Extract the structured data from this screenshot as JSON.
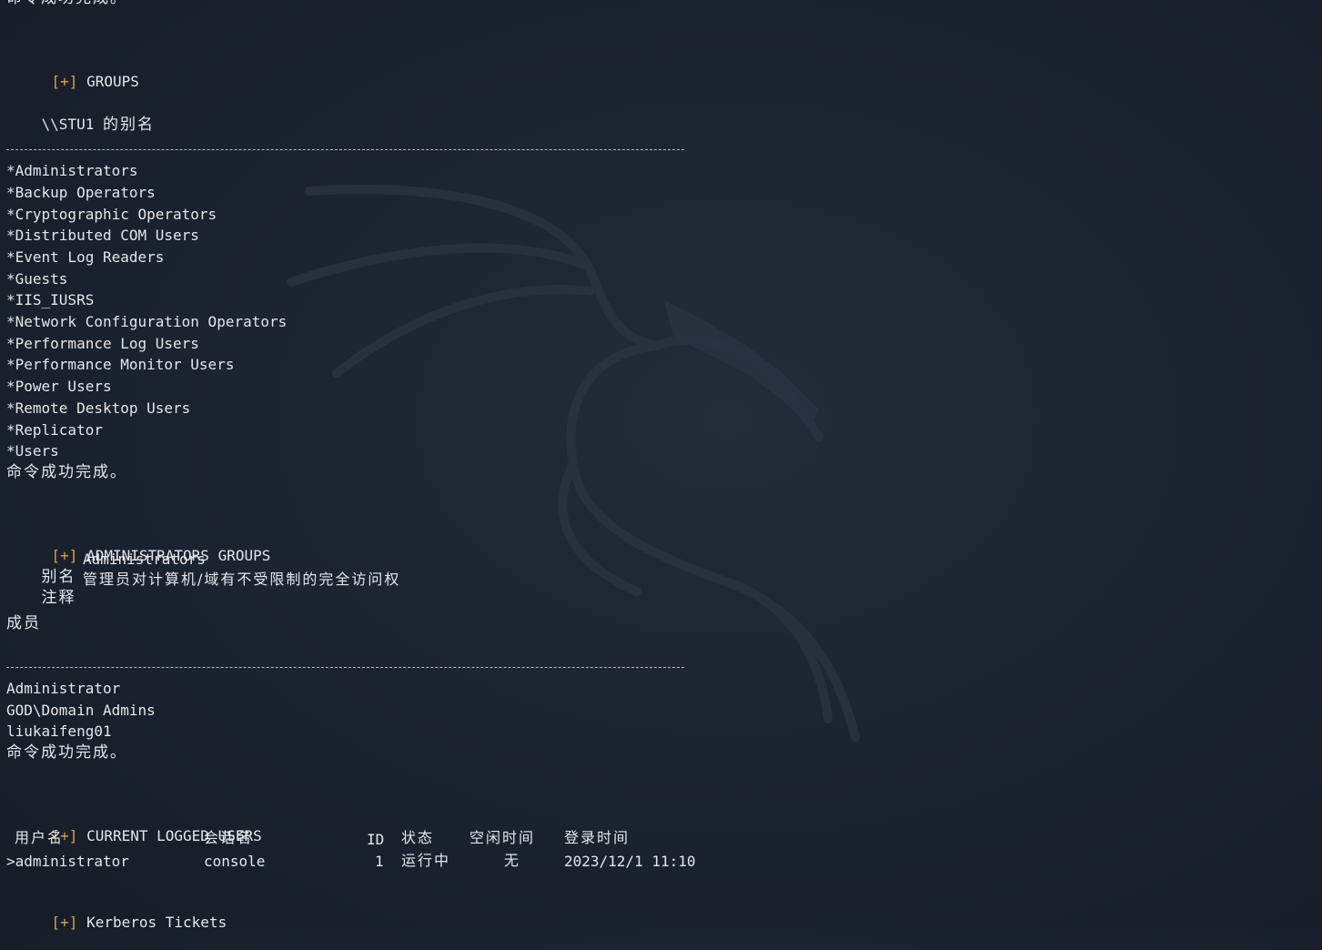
{
  "top_partial": "命令成功完成。",
  "groups_section": {
    "marker": "[+]",
    "title": "GROUPS",
    "alias_host": "\\\\STU1",
    "alias_suffix": "的别名",
    "separator": "-------------------------------------------------------------------------------",
    "items": [
      "*Administrators",
      "*Backup Operators",
      "*Cryptographic Operators",
      "*Distributed COM Users",
      "*Event Log Readers",
      "*Guests",
      "*IIS_IUSRS",
      "*Network Configuration Operators",
      "*Performance Log Users",
      "*Performance Monitor Users",
      "*Power Users",
      "*Remote Desktop Users",
      "*Replicator",
      "*Users"
    ],
    "done": "命令成功完成。"
  },
  "admin_section": {
    "marker": "[+]",
    "title": "ADMINISTRATORS GROUPS",
    "alias_label": "别名",
    "alias_value": "Administrators",
    "comment_label": "注释",
    "comment_value": "管理员对计算机/域有不受限制的完全访问权",
    "members_label": "成员",
    "separator": "-------------------------------------------------------------------------------",
    "members": [
      "Administrator",
      "GOD\\Domain Admins",
      "liukaifeng01"
    ],
    "done": "命令成功完成。"
  },
  "users_section": {
    "marker": "[+]",
    "title": "CURRENT LOGGED USERS",
    "headers": {
      "user": "用户名",
      "session": "会话名",
      "id": "ID",
      "state": "状态",
      "idle": "空闲时间",
      "logon": "登录时间"
    },
    "rows": [
      {
        "user": ">administrator",
        "session": "console",
        "id": "1",
        "state": "运行中",
        "idle": "无",
        "logon": "2023/12/1 11:10"
      }
    ]
  },
  "kerberos_section": {
    "marker": "[+]",
    "title": "Kerberos Tickets"
  }
}
